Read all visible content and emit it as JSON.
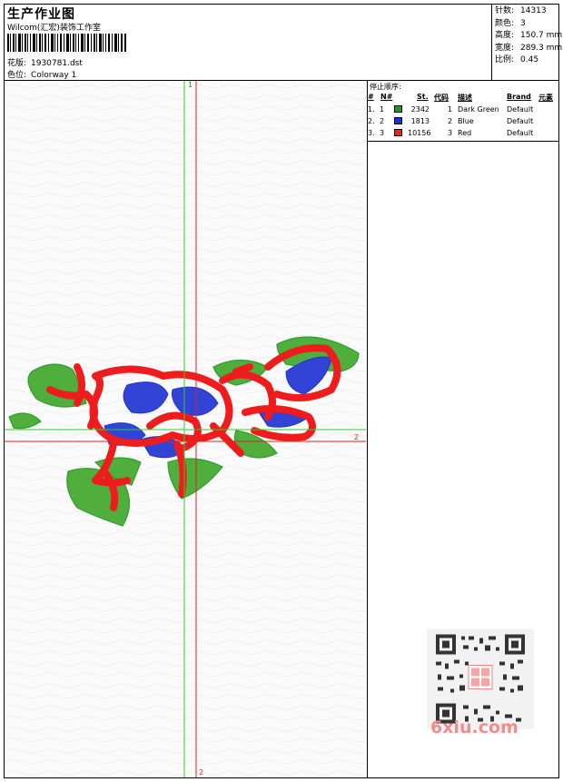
{
  "header": {
    "title": "生产作业图",
    "subtitle": "Wilcom(汇宏)装饰工作室",
    "design_label": "花版:",
    "design_value": "1930781.dst",
    "colorway_label": "色位:",
    "colorway_value": "Colorway 1"
  },
  "stats": [
    {
      "label": "针数:",
      "value": "14313"
    },
    {
      "label": "颜色:",
      "value": "3"
    },
    {
      "label": "高度:",
      "value": "150.7 mm"
    },
    {
      "label": "宽度:",
      "value": "289.3 mm"
    },
    {
      "label": "比例:",
      "value": "0.45"
    }
  ],
  "stop_sequence": {
    "title": "停止顺序:",
    "columns": [
      "#",
      "N#",
      "St.",
      "代码",
      "描述",
      "Brand",
      "元素"
    ],
    "rows": [
      {
        "num": "1.",
        "n": "1",
        "color": "#1a9c1a",
        "stitches": "2342",
        "code": "1",
        "desc": "Dark Green",
        "brand": "Default"
      },
      {
        "num": "2.",
        "n": "2",
        "color": "#1f2fd8",
        "stitches": "1813",
        "code": "2",
        "desc": "Blue",
        "brand": "Default"
      },
      {
        "num": "3.",
        "n": "3",
        "color": "#e8241c",
        "stitches": "10156",
        "code": "3",
        "desc": "Red",
        "brand": "Default"
      }
    ]
  },
  "axes": {
    "v_label_top": "1",
    "h_label_right": "2",
    "v_label_bottom": "2"
  },
  "watermark": {
    "text": "6xiu.com"
  },
  "colors": {
    "green": "#2f9e2f",
    "blue": "#2233cc",
    "red": "#ee1c1c",
    "guide_green": "#33cc33",
    "guide_red": "#dd2222"
  }
}
